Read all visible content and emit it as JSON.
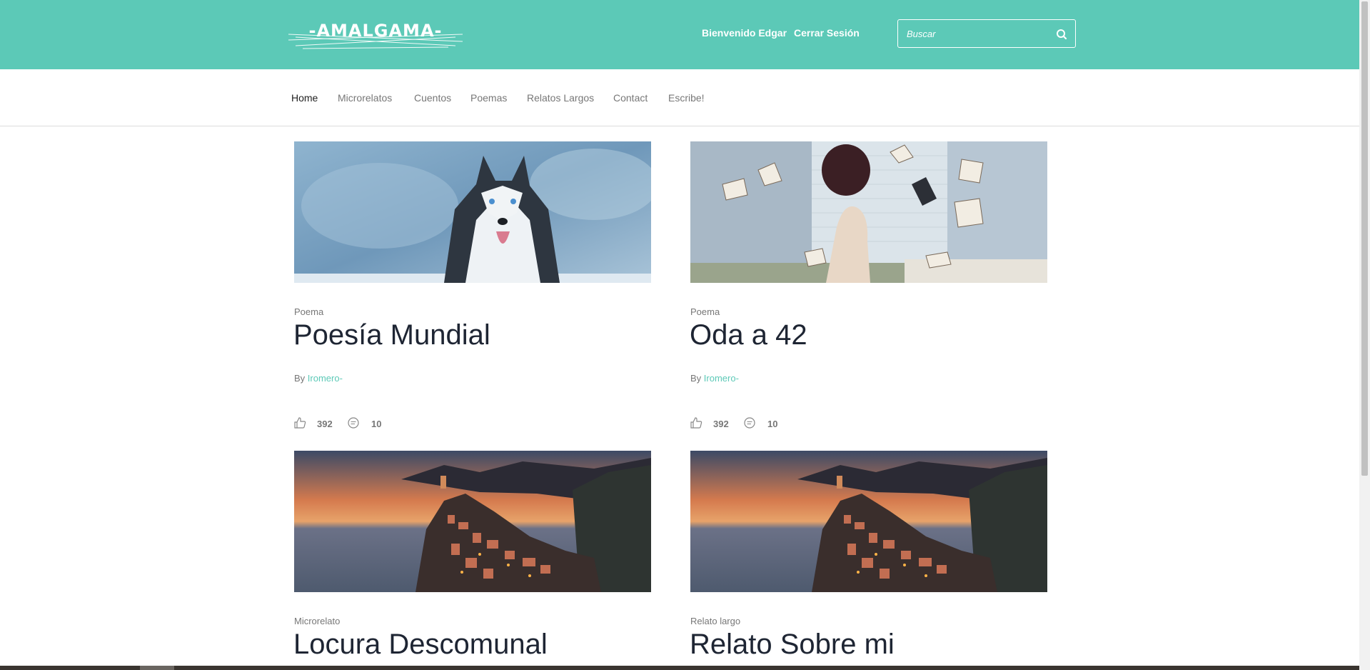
{
  "header": {
    "logo_text": "-AMALGAMA-",
    "welcome": "Bienvenido Edgar",
    "logout": "Cerrar Sesión",
    "search_placeholder": "Buscar"
  },
  "nav": {
    "items": [
      {
        "label": "Home"
      },
      {
        "label": "Microrelatos"
      },
      {
        "label": "Cuentos"
      },
      {
        "label": "Poemas"
      },
      {
        "label": "Relatos Largos"
      },
      {
        "label": "Contact"
      },
      {
        "label": "Escribe!"
      }
    ]
  },
  "posts": [
    {
      "category": "Poema",
      "title": "Poesía Mundial",
      "by": "By",
      "author": "Iromero-",
      "likes": "392",
      "comments": "10",
      "image": "husky-dog"
    },
    {
      "category": "Poema",
      "title": "Oda a 42",
      "by": "By",
      "author": "Iromero-",
      "likes": "392",
      "comments": "10",
      "image": "woman-flying-books"
    },
    {
      "category": "Microrelato",
      "title": "Locura Descomunal",
      "image": "coastal-village-sunset"
    },
    {
      "category": "Relato largo",
      "title": "Relato Sobre mi",
      "image": "coastal-village-sunset"
    }
  ],
  "colors": {
    "accent": "#5cc9b7",
    "title": "#1e2533",
    "muted": "#777777"
  }
}
